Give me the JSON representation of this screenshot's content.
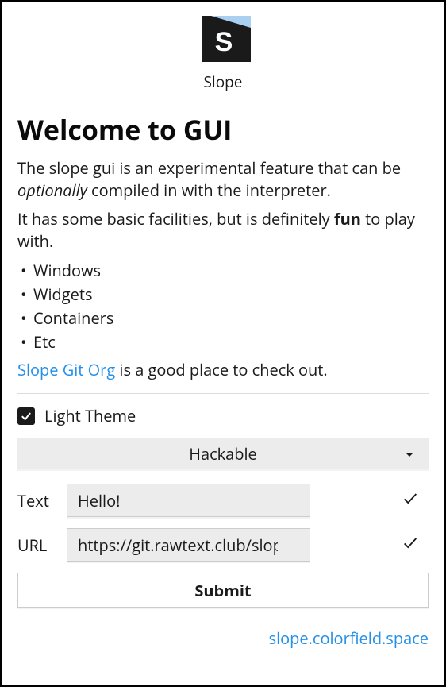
{
  "header": {
    "app_name": "Slope"
  },
  "content": {
    "title": "Welcome to GUI",
    "desc1_part1": "The slope gui is an experimental feature that can be ",
    "desc1_em": "optionally",
    "desc1_part2": " compiled in with the interpreter.",
    "desc2_part1": "It has some basic facilities, but is definitely ",
    "desc2_strong": "fun",
    "desc2_part2": " to play with.",
    "features": [
      "Windows",
      "Widgets",
      "Containers",
      "Etc"
    ],
    "link_text": "Slope Git Org",
    "link_suffix": " is a good place to check out."
  },
  "form": {
    "theme_label": "Light Theme",
    "theme_checked": true,
    "select_value": "Hackable",
    "text_label": "Text",
    "text_value": "Hello!",
    "url_label": "URL",
    "url_value": "https://git.rawtext.club/slope-lang",
    "submit_label": "Submit"
  },
  "footer": {
    "link_text": "slope.colorfield.space"
  }
}
